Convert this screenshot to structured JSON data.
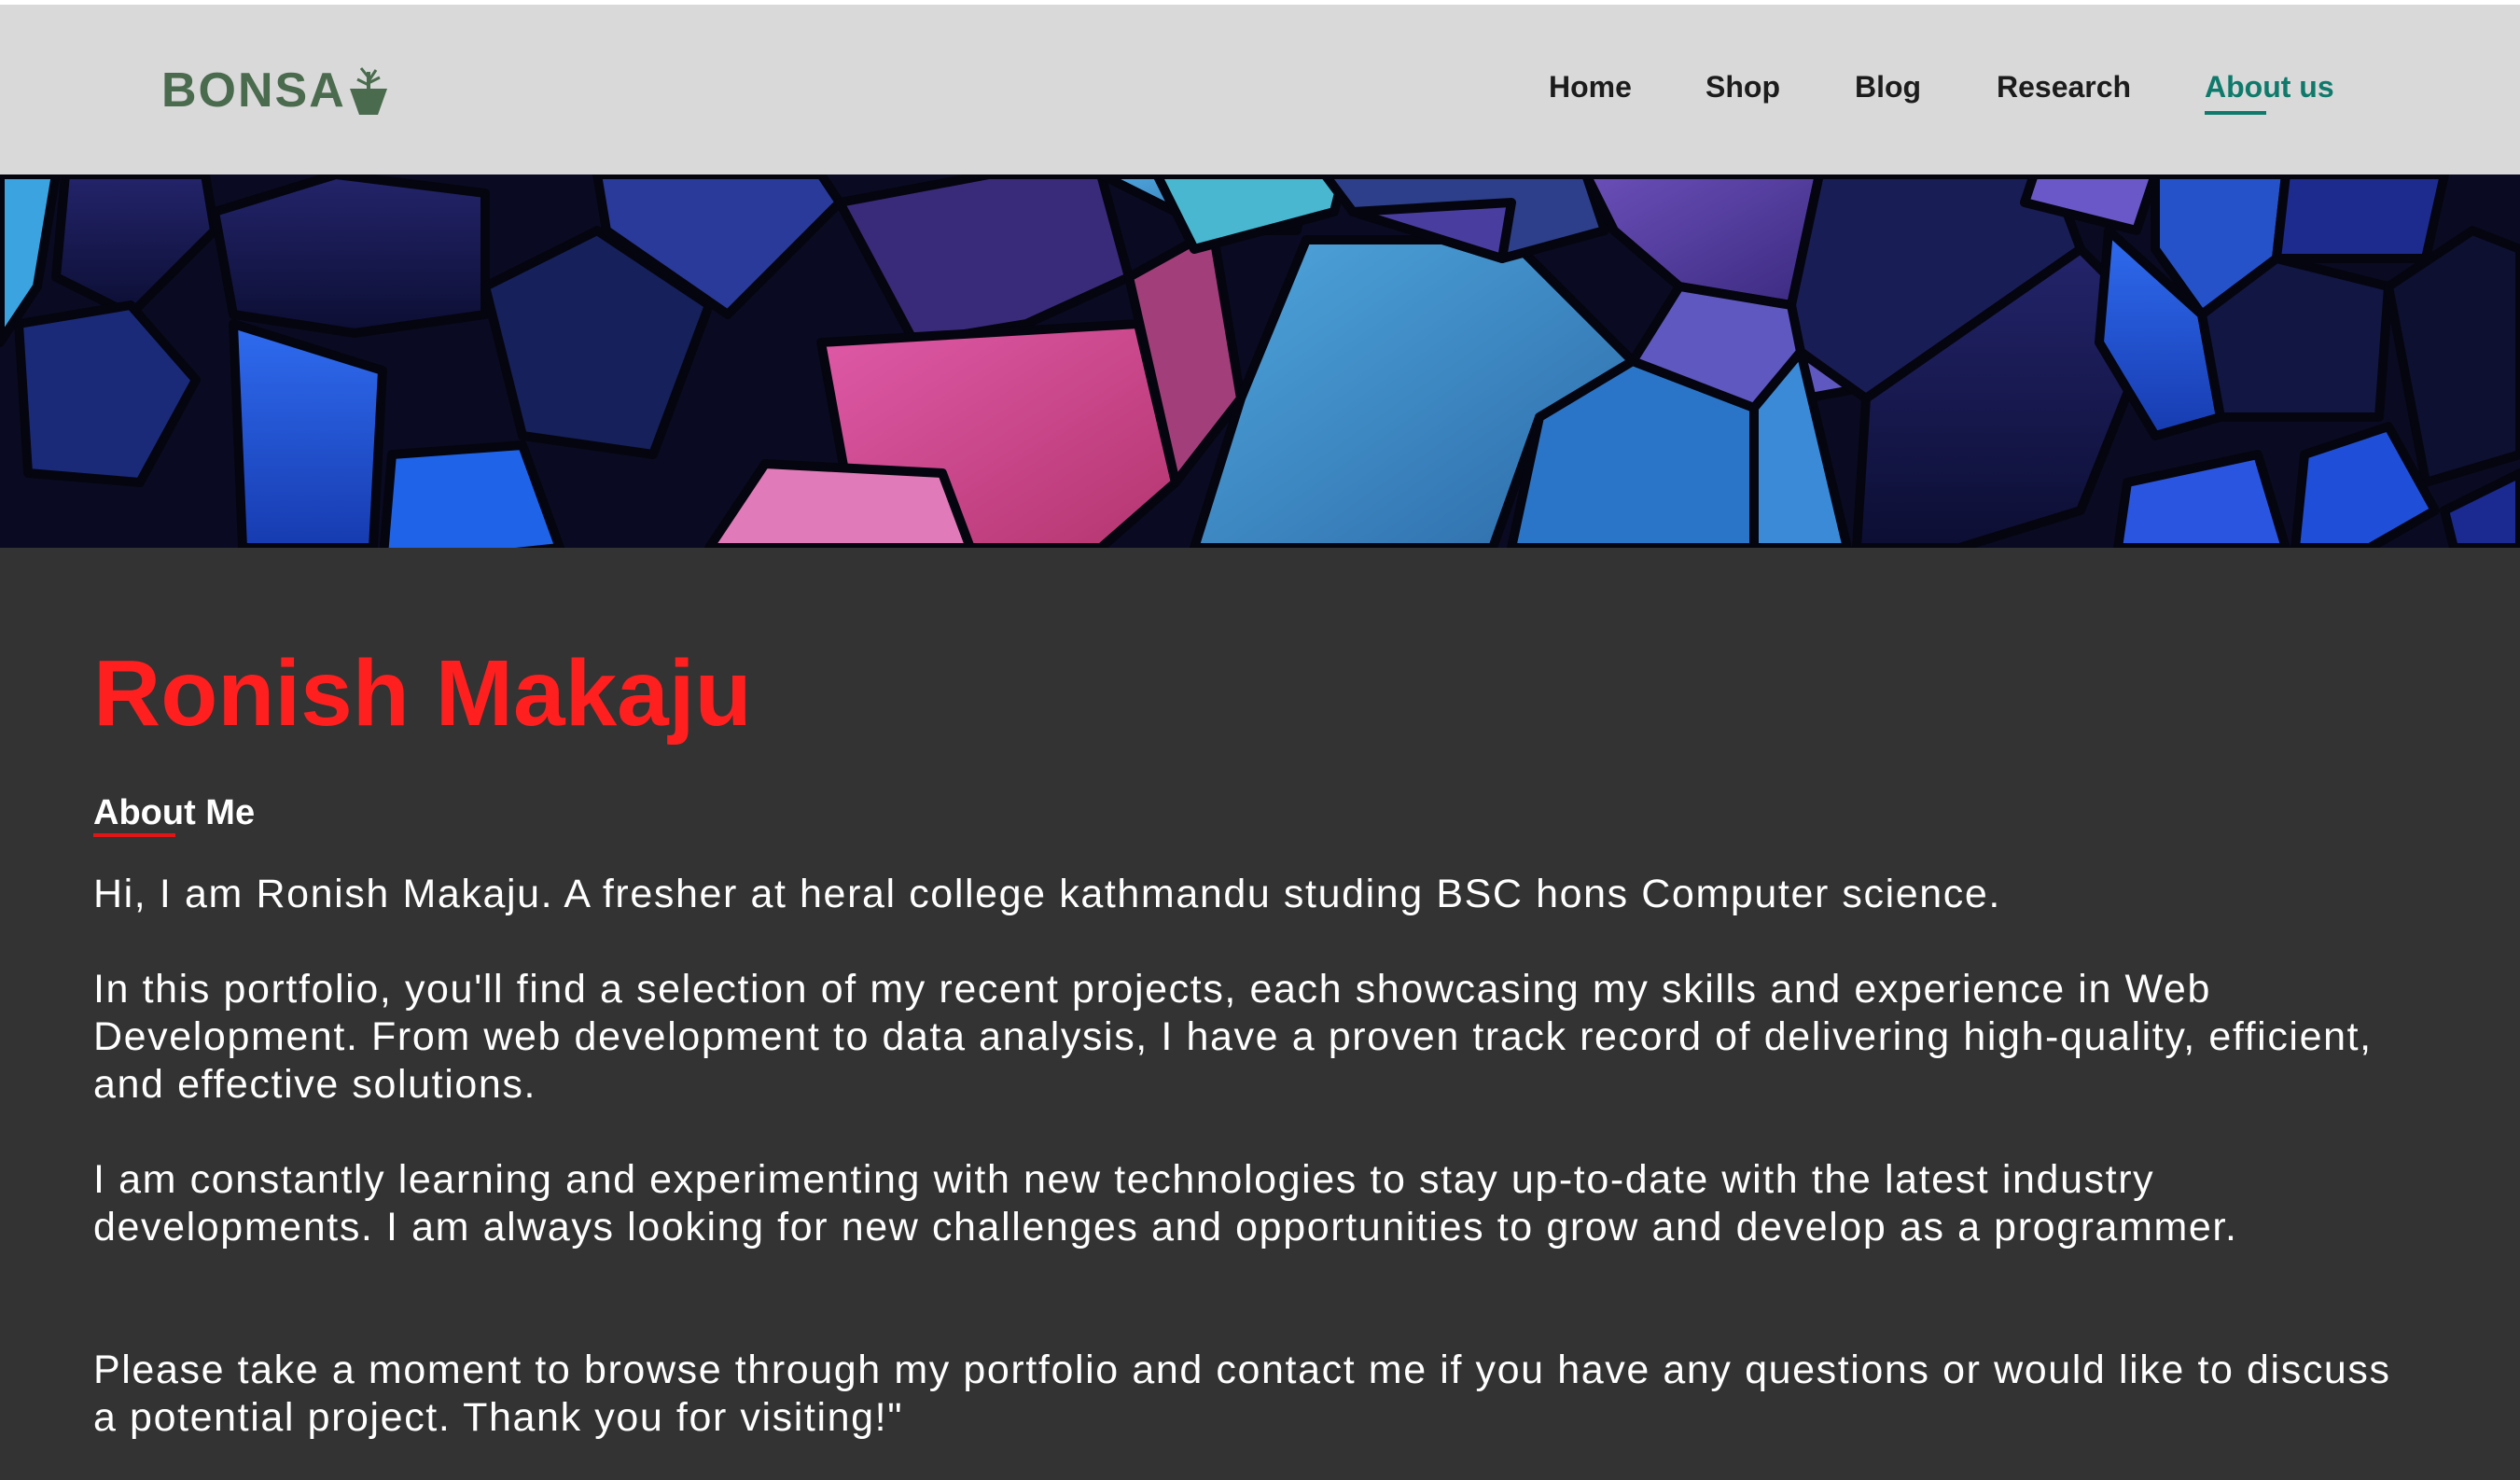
{
  "header": {
    "logo_text": "BONSA",
    "nav": [
      {
        "label": "Home",
        "active": false
      },
      {
        "label": "Shop",
        "active": false
      },
      {
        "label": "Blog",
        "active": false
      },
      {
        "label": "Research",
        "active": false
      },
      {
        "label": "About us",
        "active": true
      }
    ]
  },
  "hero": {
    "image": "abstract-polygon-background"
  },
  "main": {
    "name": "Ronish Makaju",
    "about_heading": "About Me",
    "paragraphs": [
      "Hi, I am Ronish Makaju. A fresher at heral college kathmandu studing BSC hons Computer science.",
      "In this portfolio, you'll find a selection of my recent projects, each showcasing my skills and experience in Web Development. From web development to data analysis, I have a proven track record of delivering high-quality, efficient, and effective solutions.",
      "I am constantly learning and experimenting with new technologies to stay up-to-date with the latest industry developments. I am always looking for new challenges and opportunities to grow and develop as a programmer.",
      "Please take a moment to browse through my portfolio and contact me if you have any questions or would like to discuss a potential project. Thank you for visiting!\""
    ]
  },
  "colors": {
    "nav_bg": "#d9d9d9",
    "logo": "#4a6b4d",
    "nav_active": "#0f7a6b",
    "content_bg": "#333333",
    "name": "#ff1f1f",
    "heading_underline": "#e01515"
  }
}
